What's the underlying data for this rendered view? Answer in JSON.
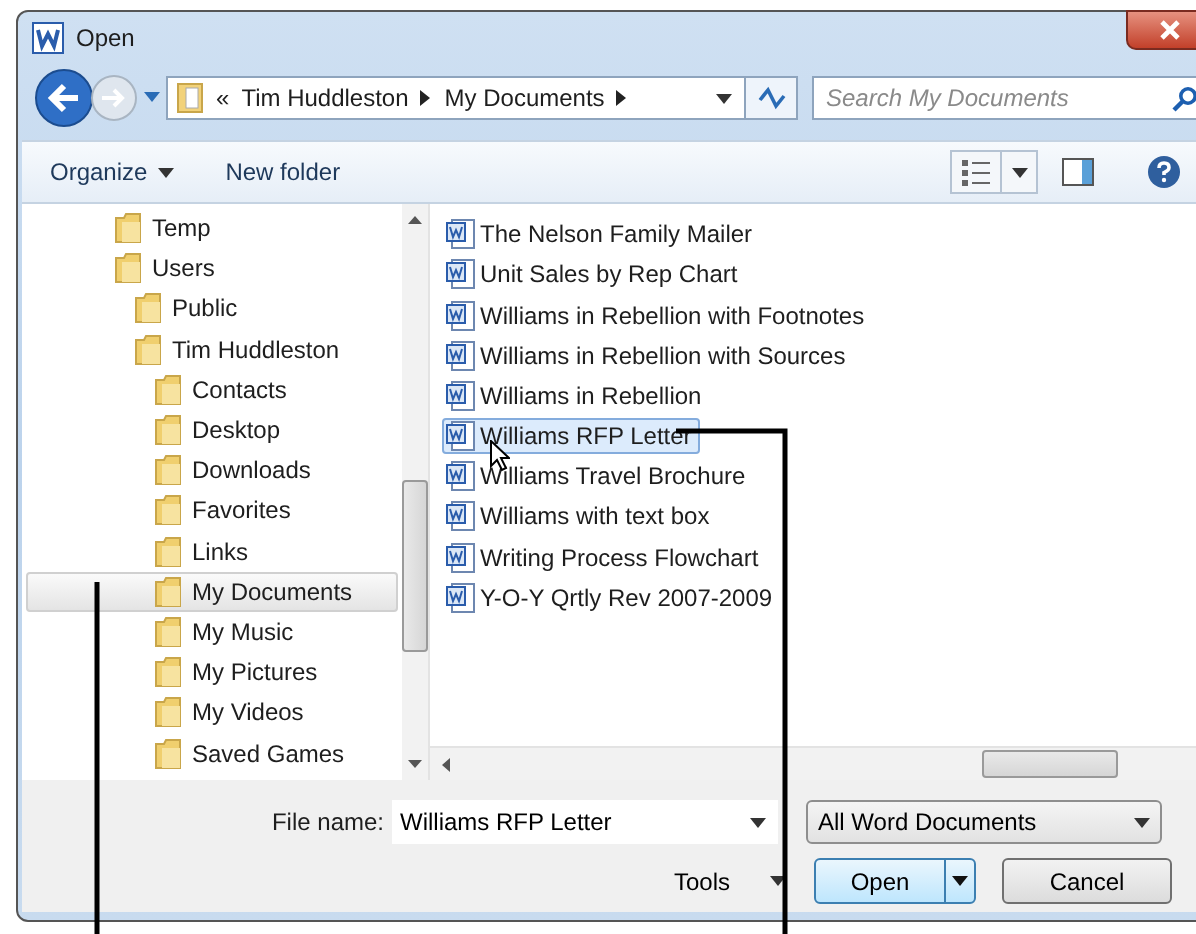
{
  "window": {
    "title": "Open"
  },
  "address": {
    "overflow": "«",
    "path": [
      "Tim Huddleston",
      "My Documents"
    ]
  },
  "search": {
    "placeholder": "Search My Documents"
  },
  "toolbar": {
    "organize": "Organize",
    "new_folder": "New folder"
  },
  "tree": [
    {
      "label": "Temp",
      "selected": false
    },
    {
      "label": "Users",
      "selected": false,
      "children": [
        {
          "label": "Public",
          "selected": false
        },
        {
          "label": "Tim Huddleston",
          "selected": false,
          "children": [
            {
              "label": "Contacts",
              "selected": false
            },
            {
              "label": "Desktop",
              "selected": false
            },
            {
              "label": "Downloads",
              "selected": false
            },
            {
              "label": "Favorites",
              "selected": false
            },
            {
              "label": "Links",
              "selected": false
            },
            {
              "label": "My Documents",
              "selected": true
            },
            {
              "label": "My Music",
              "selected": false
            },
            {
              "label": "My Pictures",
              "selected": false
            },
            {
              "label": "My Videos",
              "selected": false
            },
            {
              "label": "Saved Games",
              "selected": false
            }
          ]
        }
      ]
    }
  ],
  "files": [
    {
      "name": "The Nelson Family Mailer",
      "selected": false
    },
    {
      "name": "Unit Sales by Rep Chart",
      "selected": false
    },
    {
      "name": "Williams in Rebellion with Footnotes",
      "selected": false
    },
    {
      "name": "Williams in Rebellion with Sources",
      "selected": false
    },
    {
      "name": "Williams in Rebellion",
      "selected": false
    },
    {
      "name": "Williams RFP Letter",
      "selected": true
    },
    {
      "name": "Williams Travel Brochure",
      "selected": false
    },
    {
      "name": "Williams with text box",
      "selected": false
    },
    {
      "name": "Writing Process Flowchart",
      "selected": false
    },
    {
      "name": "Y-O-Y Qrtly Rev 2007-2009",
      "selected": false
    }
  ],
  "file_name": {
    "label": "File name:",
    "value": "Williams RFP Letter"
  },
  "file_type": "All Word Documents",
  "buttons": {
    "tools": "Tools",
    "open": "Open",
    "cancel": "Cancel"
  }
}
